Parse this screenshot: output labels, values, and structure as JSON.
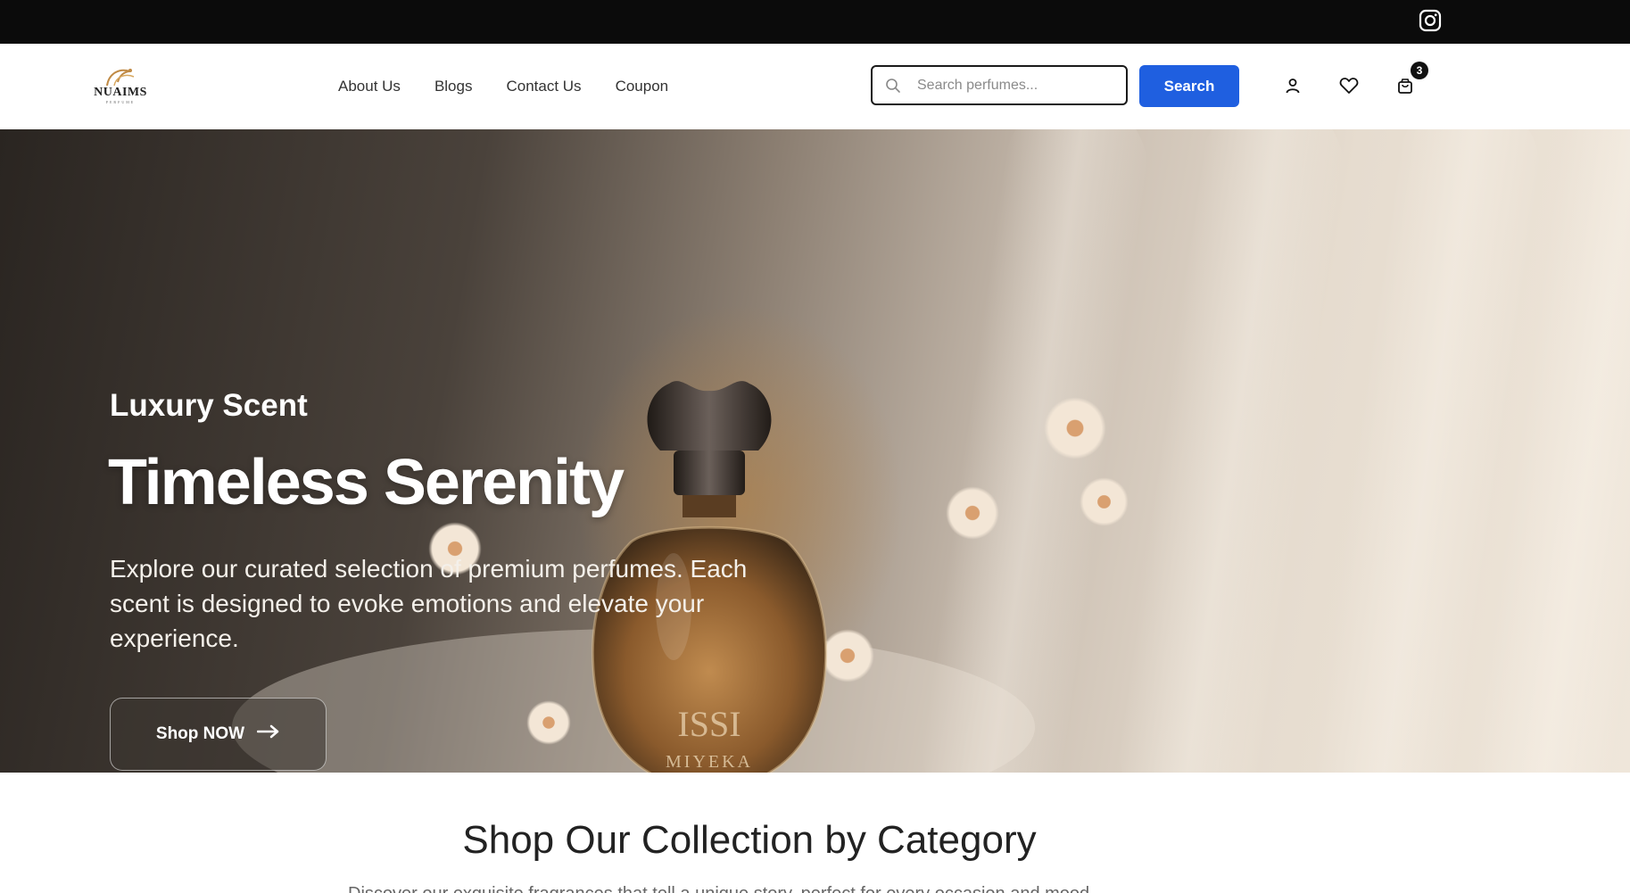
{
  "brand": {
    "name": "NUAIMS",
    "tagline": "PERFUME",
    "accent_color": "#1f5fe0"
  },
  "topbar": {
    "icons": [
      "instagram-icon"
    ]
  },
  "nav": {
    "items": [
      {
        "label": "About Us"
      },
      {
        "label": "Blogs"
      },
      {
        "label": "Contact Us"
      },
      {
        "label": "Coupon"
      }
    ]
  },
  "search": {
    "placeholder": "Search perfumes...",
    "value": "",
    "button_label": "Search"
  },
  "header_icons": {
    "account": "user-icon",
    "wishlist": "heart-icon",
    "cart": "shopping-bag-icon",
    "cart_count": "3"
  },
  "hero": {
    "subtitle": "Luxury Scent",
    "title": "Timeless Serenity",
    "description": "Explore our curated selection of premium perfumes. Each scent is designed to evoke emotions and elevate your experience.",
    "cta_label": "Shop NOW",
    "bottle_label_top": "ISSI",
    "bottle_label_bottom": "MIYEKA"
  },
  "collection": {
    "title": "Shop Our Collection by Category",
    "description": "Discover our exquisite fragrances that tell a unique story, perfect for every occasion and mood."
  }
}
